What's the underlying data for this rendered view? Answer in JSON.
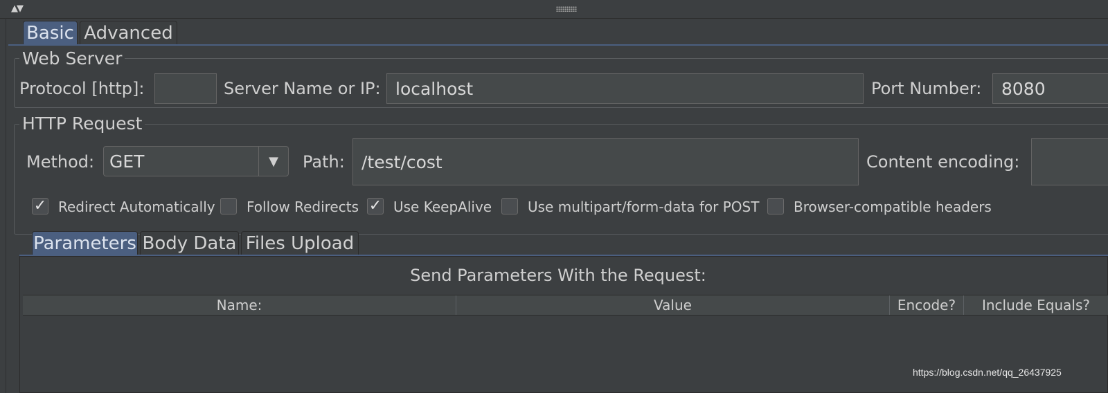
{
  "tabs": [
    {
      "label": "Basic",
      "active": true
    },
    {
      "label": "Advanced",
      "active": false
    }
  ],
  "web_server": {
    "title": "Web Server",
    "protocol_label": "Protocol [http]:",
    "protocol_value": "",
    "server_label": "Server Name or IP:",
    "server_value": "localhost",
    "port_label": "Port Number:",
    "port_value": "8080"
  },
  "http_request": {
    "title": "HTTP Request",
    "method_label": "Method:",
    "method_value": "GET",
    "path_label": "Path:",
    "path_value": "/test/cost",
    "encoding_label": "Content encoding:",
    "encoding_value": ""
  },
  "options": [
    {
      "label": "Redirect Automatically",
      "checked": true
    },
    {
      "label": "Follow Redirects",
      "checked": false
    },
    {
      "label": "Use KeepAlive",
      "checked": true
    },
    {
      "label": "Use multipart/form-data for POST",
      "checked": false
    },
    {
      "label": "Browser-compatible headers",
      "checked": false
    }
  ],
  "sub_tabs": [
    {
      "label": "Parameters",
      "active": true
    },
    {
      "label": "Body Data",
      "active": false
    },
    {
      "label": "Files Upload",
      "active": false
    }
  ],
  "parameters": {
    "caption": "Send Parameters With the Request:",
    "columns": [
      "Name:",
      "Value",
      "Encode?",
      "Include Equals?"
    ]
  },
  "watermark": "https://blog.csdn.net/qq_26437925",
  "colors": {
    "accent": "#4b5f80",
    "background": "#3c3f41",
    "field": "#45494a"
  }
}
